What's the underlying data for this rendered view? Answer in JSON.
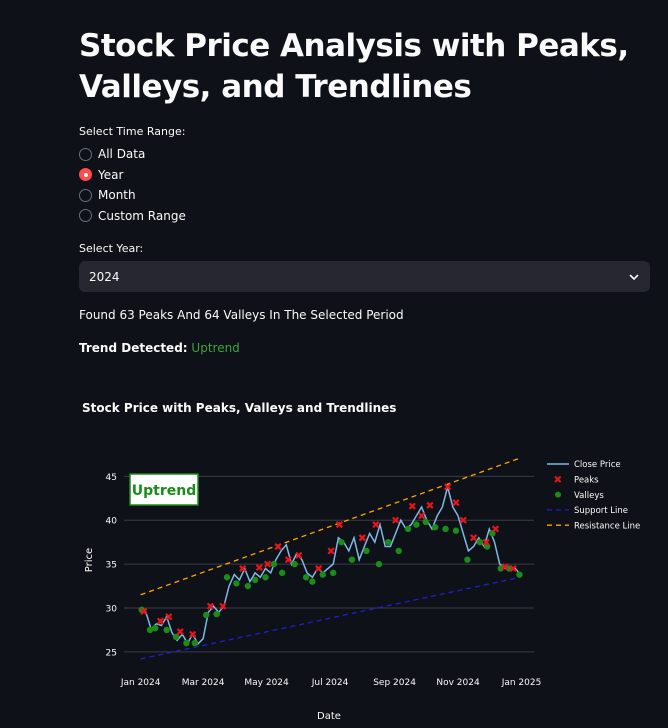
{
  "page": {
    "title": "Stock Price Analysis with Peaks, Valleys, and Trendlines"
  },
  "time_range": {
    "label": "Select Time Range:",
    "options": [
      "All Data",
      "Year",
      "Month",
      "Custom Range"
    ],
    "selected": "Year"
  },
  "year_select": {
    "label": "Select Year:",
    "value": "2024"
  },
  "summary": {
    "found_text": "Found 63 Peaks And 64 Valleys In The Selected Period",
    "trend_key": "Trend Detected:",
    "trend_value": "Uptrend"
  },
  "colors": {
    "accent": "#ff4b4b",
    "uptrend": "#3fa33f",
    "close_line": "#7fb8e8",
    "peak": "#e8151b",
    "valley": "#1a8c1a",
    "support": "#1f1fd0",
    "resistance": "#ffa500"
  },
  "chart_data": {
    "type": "line",
    "title": "Stock Price with Peaks, Valleys and Trendlines",
    "xlabel": "Date",
    "ylabel": "Price",
    "annotation": "Uptrend",
    "x_ticks": [
      "Jan 2024",
      "Mar 2024",
      "May 2024",
      "Jul 2024",
      "Sep 2024",
      "Nov 2024",
      "Jan 2025"
    ],
    "y_ticks": [
      25,
      30,
      35,
      40,
      45
    ],
    "ylim": [
      23.5,
      48
    ],
    "grid": true,
    "legend_position": "right",
    "series": [
      {
        "name": "Close Price",
        "kind": "line",
        "x": [
          "2024-01-01",
          "2024-01-06",
          "2024-01-11",
          "2024-01-16",
          "2024-01-21",
          "2024-01-26",
          "2024-01-31",
          "2024-02-05",
          "2024-02-10",
          "2024-02-15",
          "2024-02-20",
          "2024-02-25",
          "2024-03-01",
          "2024-03-06",
          "2024-03-11",
          "2024-03-16",
          "2024-03-21",
          "2024-03-26",
          "2024-03-31",
          "2024-04-05",
          "2024-04-10",
          "2024-04-15",
          "2024-04-20",
          "2024-04-25",
          "2024-04-30",
          "2024-05-05",
          "2024-05-10",
          "2024-05-15",
          "2024-05-20",
          "2024-05-25",
          "2024-05-30",
          "2024-06-04",
          "2024-06-09",
          "2024-06-14",
          "2024-06-19",
          "2024-06-24",
          "2024-06-29",
          "2024-07-04",
          "2024-07-09",
          "2024-07-14",
          "2024-07-19",
          "2024-07-24",
          "2024-07-29",
          "2024-08-03",
          "2024-08-08",
          "2024-08-13",
          "2024-08-18",
          "2024-08-23",
          "2024-08-28",
          "2024-09-02",
          "2024-09-07",
          "2024-09-12",
          "2024-09-17",
          "2024-09-22",
          "2024-09-27",
          "2024-10-02",
          "2024-10-07",
          "2024-10-12",
          "2024-10-17",
          "2024-10-22",
          "2024-10-27",
          "2024-11-01",
          "2024-11-06",
          "2024-11-11",
          "2024-11-16",
          "2024-11-21",
          "2024-11-26",
          "2024-12-01",
          "2024-12-06",
          "2024-12-11",
          "2024-12-16",
          "2024-12-21",
          "2024-12-26",
          "2024-12-31"
        ],
        "y": [
          29.8,
          29.5,
          27.6,
          28.2,
          28.0,
          29.0,
          27.2,
          26.3,
          27.0,
          26.0,
          27.0,
          25.9,
          26.5,
          29.5,
          30.2,
          29.5,
          30.2,
          32.5,
          33.8,
          33.2,
          34.5,
          33.0,
          34.0,
          33.5,
          34.5,
          34.0,
          35.5,
          36.5,
          37.2,
          35.0,
          36.2,
          35.5,
          34.0,
          33.5,
          34.5,
          34.0,
          34.5,
          35.0,
          38.0,
          37.5,
          36.5,
          38.0,
          35.5,
          37.0,
          38.5,
          37.5,
          39.5,
          37.0,
          37.0,
          38.5,
          40.0,
          39.0,
          39.5,
          40.5,
          41.5,
          40.0,
          39.0,
          40.5,
          41.5,
          43.8,
          41.5,
          40.5,
          38.5,
          36.5,
          37.0,
          38.0,
          37.0,
          39.0,
          37.5,
          35.0,
          34.5,
          34.5,
          34.5,
          33.8
        ]
      },
      {
        "name": "Peaks",
        "kind": "marker",
        "x": [
          "2024-01-04",
          "2024-01-20",
          "2024-01-28",
          "2024-02-08",
          "2024-02-20",
          "2024-03-08",
          "2024-03-20",
          "2024-04-08",
          "2024-04-24",
          "2024-05-02",
          "2024-05-12",
          "2024-05-22",
          "2024-06-01",
          "2024-06-20",
          "2024-07-02",
          "2024-07-10",
          "2024-08-01",
          "2024-08-14",
          "2024-09-02",
          "2024-09-18",
          "2024-09-27",
          "2024-10-05",
          "2024-10-22",
          "2024-10-30",
          "2024-11-06",
          "2024-11-16",
          "2024-11-28",
          "2024-12-07",
          "2024-12-16",
          "2024-12-24"
        ],
        "y": [
          29.6,
          28.5,
          29.0,
          27.3,
          27.0,
          30.2,
          30.2,
          34.5,
          34.6,
          35.0,
          37.0,
          35.5,
          36.0,
          34.5,
          36.5,
          39.5,
          38.0,
          39.5,
          40.0,
          41.6,
          40.5,
          41.7,
          43.8,
          42.0,
          40.0,
          38.0,
          37.5,
          39.0,
          34.7,
          34.5
        ]
      },
      {
        "name": "Valleys",
        "kind": "marker",
        "x": [
          "2024-01-02",
          "2024-01-10",
          "2024-01-15",
          "2024-01-26",
          "2024-02-04",
          "2024-02-14",
          "2024-02-22",
          "2024-03-04",
          "2024-03-14",
          "2024-03-24",
          "2024-04-02",
          "2024-04-13",
          "2024-04-20",
          "2024-04-30",
          "2024-05-08",
          "2024-05-16",
          "2024-05-28",
          "2024-06-08",
          "2024-06-14",
          "2024-06-24",
          "2024-07-04",
          "2024-07-12",
          "2024-07-22",
          "2024-08-05",
          "2024-08-17",
          "2024-08-26",
          "2024-09-05",
          "2024-09-14",
          "2024-09-22",
          "2024-10-01",
          "2024-10-10",
          "2024-10-20",
          "2024-10-30",
          "2024-11-10",
          "2024-11-22",
          "2024-11-29",
          "2024-12-04",
          "2024-12-12",
          "2024-12-20",
          "2024-12-30"
        ],
        "y": [
          29.8,
          27.5,
          27.7,
          27.5,
          26.7,
          26.0,
          26.0,
          29.2,
          29.3,
          33.5,
          32.8,
          32.5,
          33.2,
          33.5,
          35.0,
          34.0,
          35.0,
          33.5,
          33.0,
          33.8,
          34.0,
          37.5,
          35.5,
          36.5,
          35.0,
          37.5,
          36.5,
          39.0,
          39.5,
          39.8,
          39.2,
          39.0,
          38.8,
          35.5,
          37.5,
          37.0,
          38.5,
          34.5,
          34.5,
          33.8
        ]
      },
      {
        "name": "Support Line",
        "kind": "dashed",
        "x": [
          "2024-01-01",
          "2024-12-31"
        ],
        "y": [
          24.2,
          33.5
        ]
      },
      {
        "name": "Resistance Line",
        "kind": "dashed",
        "x": [
          "2024-01-01",
          "2024-12-31"
        ],
        "y": [
          31.5,
          47.1
        ]
      }
    ]
  }
}
